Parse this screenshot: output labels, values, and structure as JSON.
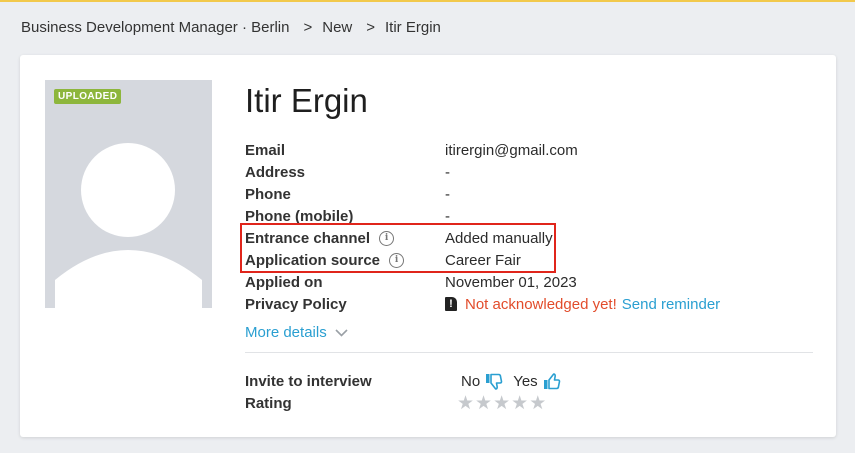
{
  "breadcrumb": {
    "job": "Business Development Manager · Berlin",
    "stage": "New",
    "candidate": "Itir Ergin",
    "separator": ">"
  },
  "candidate": {
    "name": "Itir Ergin",
    "photo_badge": "UPLOADED",
    "fields": [
      {
        "label": "Email",
        "value": "itirergin@gmail.com"
      },
      {
        "label": "Address",
        "value": "-"
      },
      {
        "label": "Phone",
        "value": "-"
      },
      {
        "label": "Phone (mobile)",
        "value": "-"
      },
      {
        "label": "Entrance channel",
        "value": "Added manually",
        "info_icon": "i"
      },
      {
        "label": "Application source",
        "value": "Career Fair",
        "info_icon": "i"
      },
      {
        "label": "Applied on",
        "value": "November 01, 2023"
      },
      {
        "label": "Privacy Policy",
        "warning_icon": "!",
        "value": "Not acknowledged yet!",
        "action": "Send reminder"
      }
    ],
    "more_details": "More details",
    "invite_label": "Invite to interview",
    "invite_no": "No",
    "invite_yes": "Yes",
    "rating_label": "Rating",
    "rating": 0,
    "rating_max": 5
  },
  "colors": {
    "accent": "#2a9fd1",
    "warning": "#e24c2b",
    "badge": "#8db63c",
    "highlight_box": "#e0251b"
  },
  "icons": [
    "info-icon",
    "warning-icon",
    "chevron-down-icon",
    "thumbs-down-icon",
    "thumbs-up-icon",
    "star-icon"
  ]
}
